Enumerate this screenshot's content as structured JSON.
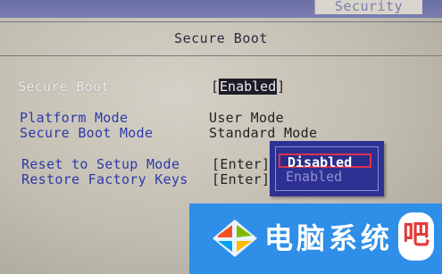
{
  "tabs": {
    "security": "Security"
  },
  "panel": {
    "title": "Secure Boot"
  },
  "settings": {
    "secure_boot": {
      "label": "Secure Boot",
      "value": "Enabled"
    },
    "platform_mode": {
      "label": "Platform Mode",
      "value": "User Mode"
    },
    "secure_boot_mode": {
      "label": "Secure Boot Mode",
      "value": "Standard Mode"
    },
    "reset_setup_mode": {
      "label": "Reset to Setup Mode",
      "value": "[Enter]"
    },
    "restore_factory_keys": {
      "label": "Restore Factory Keys",
      "value": "[Enter]"
    }
  },
  "popup": {
    "options": [
      "Disabled",
      "Enabled"
    ],
    "selected": "Disabled"
  },
  "watermark": {
    "text": "电脑系统",
    "badge": "吧"
  },
  "colors": {
    "bios_blue": "#2e3092",
    "label_blue": "#2d3aa8",
    "selection_red": "#e0304a",
    "watermark_blue": "#2f8ee8"
  }
}
